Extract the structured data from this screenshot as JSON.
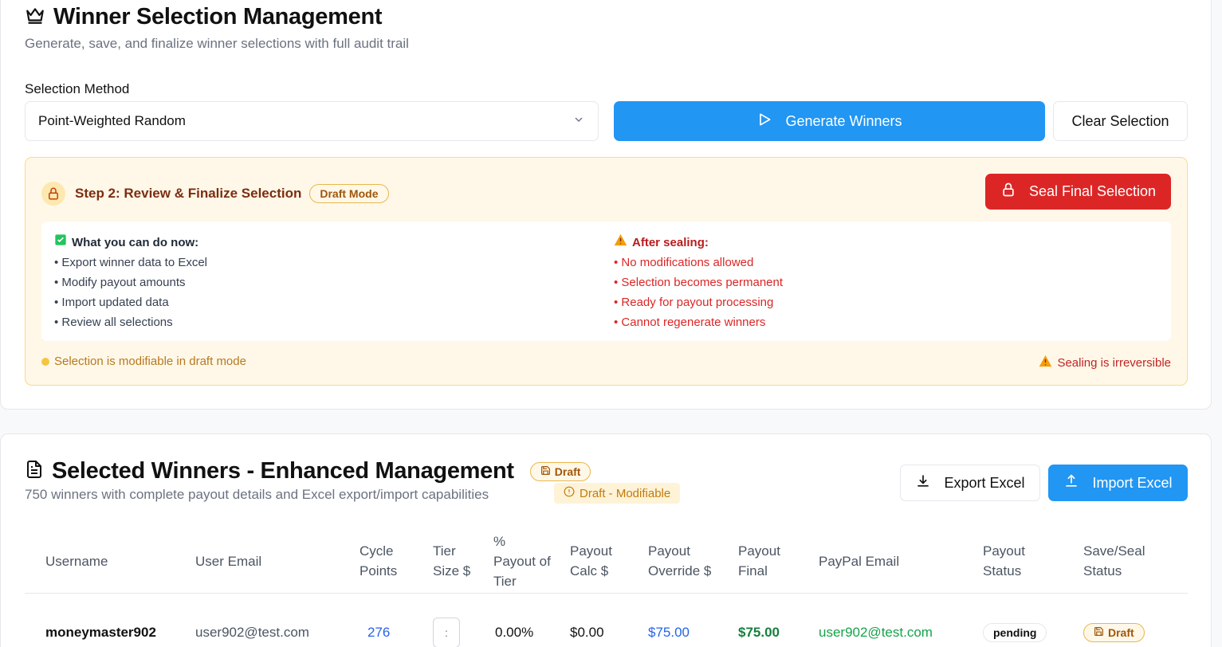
{
  "header": {
    "title": "Winner Selection Management",
    "subtitle": "Generate, save, and finalize winner selections with full audit trail"
  },
  "selection": {
    "label": "Selection Method",
    "value": "Point-Weighted Random",
    "generate_label": "Generate Winners",
    "clear_label": "Clear Selection"
  },
  "review": {
    "step_title": "Step 2: Review & Finalize Selection",
    "mode_badge": "Draft Mode",
    "seal_label": "Seal Final Selection",
    "can_do_title": "What you can do now:",
    "can_do": [
      "• Export winner data to Excel",
      "• Modify payout amounts",
      "• Import updated data",
      "• Review all selections"
    ],
    "after_title": "After sealing:",
    "after": [
      "• No modifications allowed",
      "• Selection becomes permanent",
      "• Ready for payout processing",
      "• Cannot regenerate winners"
    ],
    "footer_left": "Selection is modifiable in draft mode",
    "footer_right": "Sealing is irreversible"
  },
  "winners": {
    "title": "Selected Winners - Enhanced Management",
    "badge": "Draft",
    "subtitle": "750 winners with complete payout details and Excel export/import capabilities",
    "modifiable": "Draft - Modifiable",
    "export_label": "Export Excel",
    "import_label": "Import Excel",
    "columns": [
      "Username",
      "User Email",
      "Cycle Points",
      "Tier Size $",
      "% Payout of Tier",
      "Payout Calc $",
      "Payout Override $",
      "Payout Final",
      "PayPal Email",
      "Payout Status",
      "Save/Seal Status"
    ],
    "rows": [
      {
        "username": "moneymaster902",
        "email": "user902@test.com",
        "points": "276",
        "tier": ":",
        "pct": "0.00%",
        "calc": "$0.00",
        "override": "$75.00",
        "final": "$75.00",
        "paypal": "user902@test.com",
        "status": "pending",
        "seal": "Draft"
      }
    ]
  },
  "colors": {
    "primary": "#2196f3",
    "danger": "#dc2626",
    "warning_bg": "#fff8e8",
    "success": "#16a34a"
  }
}
